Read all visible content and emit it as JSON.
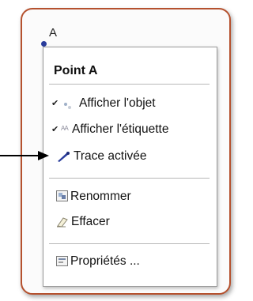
{
  "point": {
    "label": "A"
  },
  "menu": {
    "title": "Point A",
    "items": [
      {
        "label": "Afficher l'objet",
        "checked": true,
        "icon": "show-object-icon"
      },
      {
        "label": "Afficher l'étiquette",
        "checked": true,
        "icon": "show-label-icon"
      },
      {
        "label": "Trace activée",
        "checked": false,
        "icon": "pen-icon"
      },
      {
        "label": "Renommer",
        "checked": false,
        "icon": "rename-icon"
      },
      {
        "label": "Effacer",
        "checked": false,
        "icon": "eraser-icon"
      },
      {
        "label": "Propriétés ...",
        "checked": false,
        "icon": "properties-icon"
      }
    ]
  },
  "colors": {
    "frame_border": "#b5512e",
    "point": "#2a3d9c",
    "pen": "#2a3d9c"
  }
}
